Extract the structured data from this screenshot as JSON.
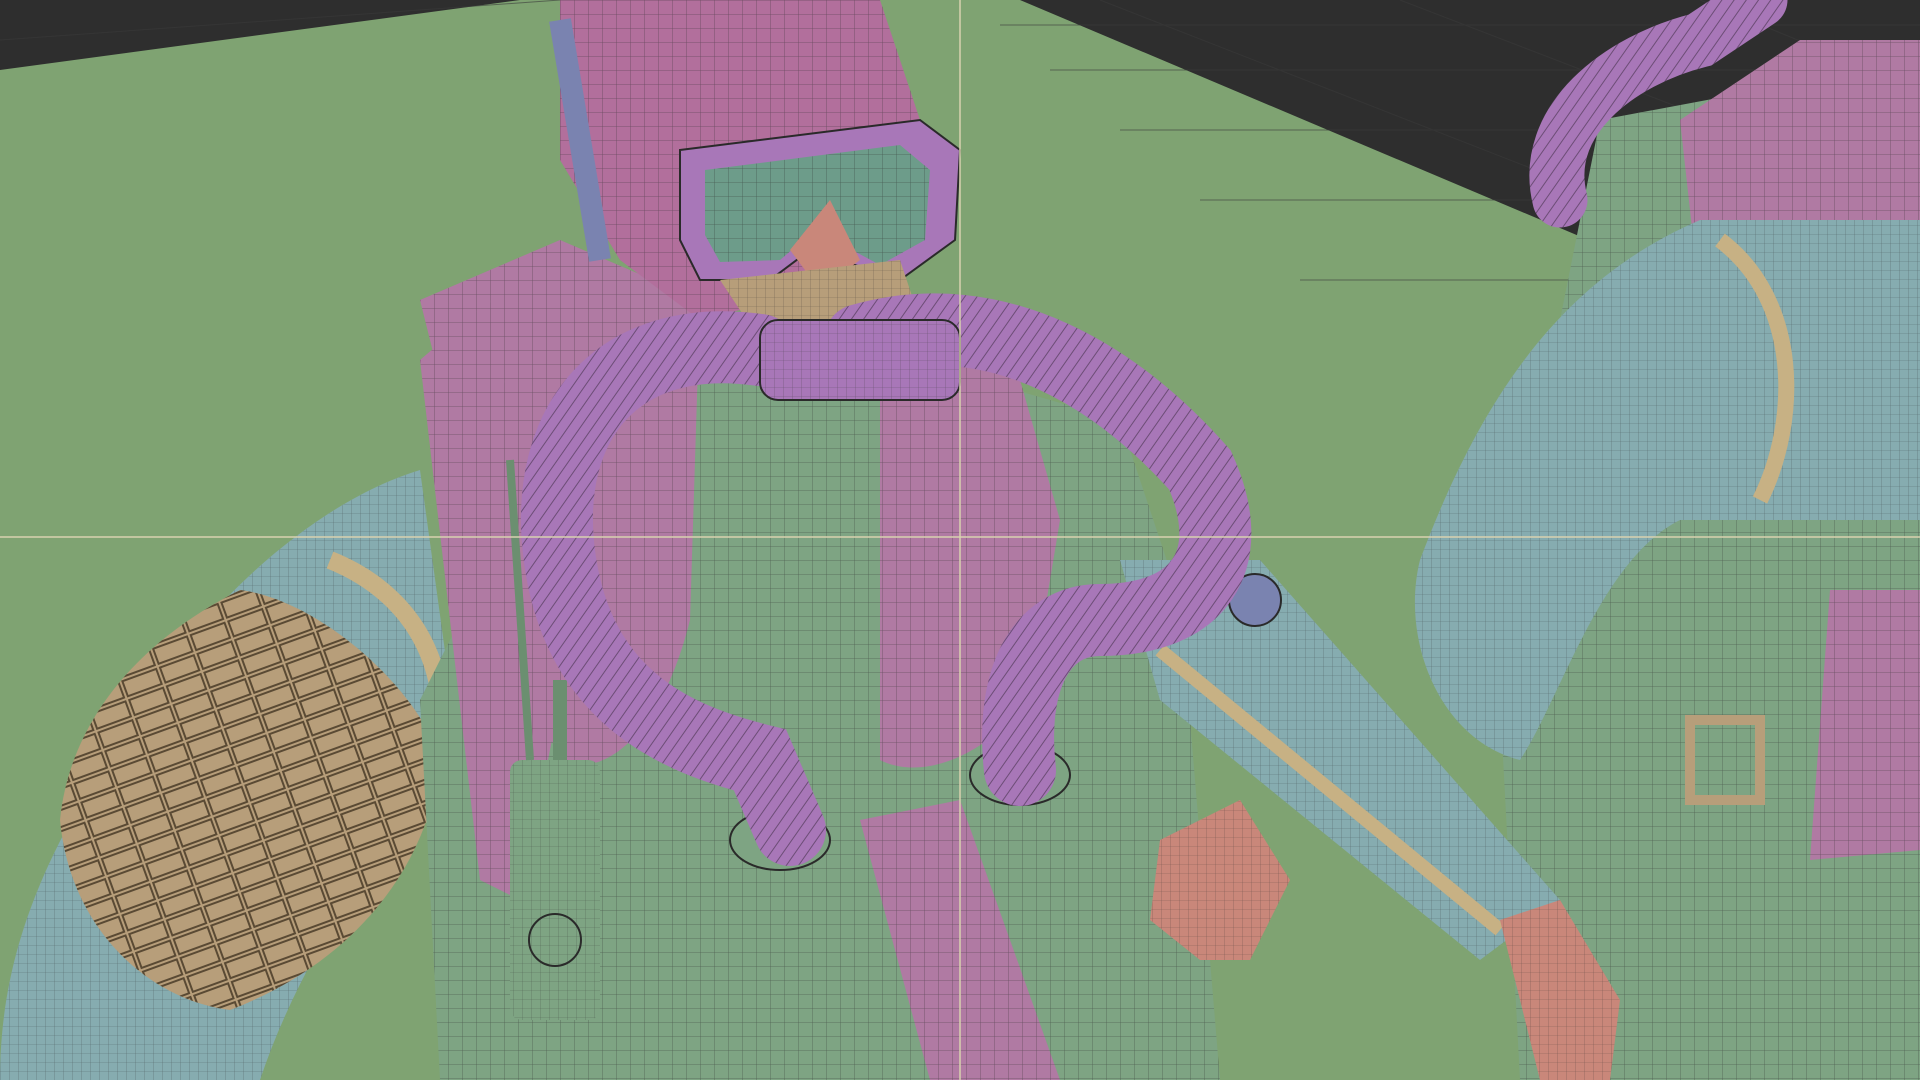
{
  "viewport": {
    "background_top": "#2e2e2e",
    "ground_plane": "#7fa372",
    "grid_line": "#3a3a3a",
    "crosshair": "#d8d2b0",
    "wire": "#2a2a2a"
  },
  "materials": {
    "suit": "#86acb0",
    "vest": "#7ea483",
    "gear_pink": "#b07aa3",
    "hose_purple": "#a877b8",
    "hood_pink": "#b26f9c",
    "strap_blue": "#7a83b0",
    "skin": "#c9877a",
    "tan": "#b79e7a",
    "lens": "#6d9c8a",
    "trim": "#c7b184"
  },
  "scene": {
    "description_icon": "3d-mesh-wireframe",
    "objects": [
      "diver-character-center",
      "diver-character-right"
    ]
  }
}
